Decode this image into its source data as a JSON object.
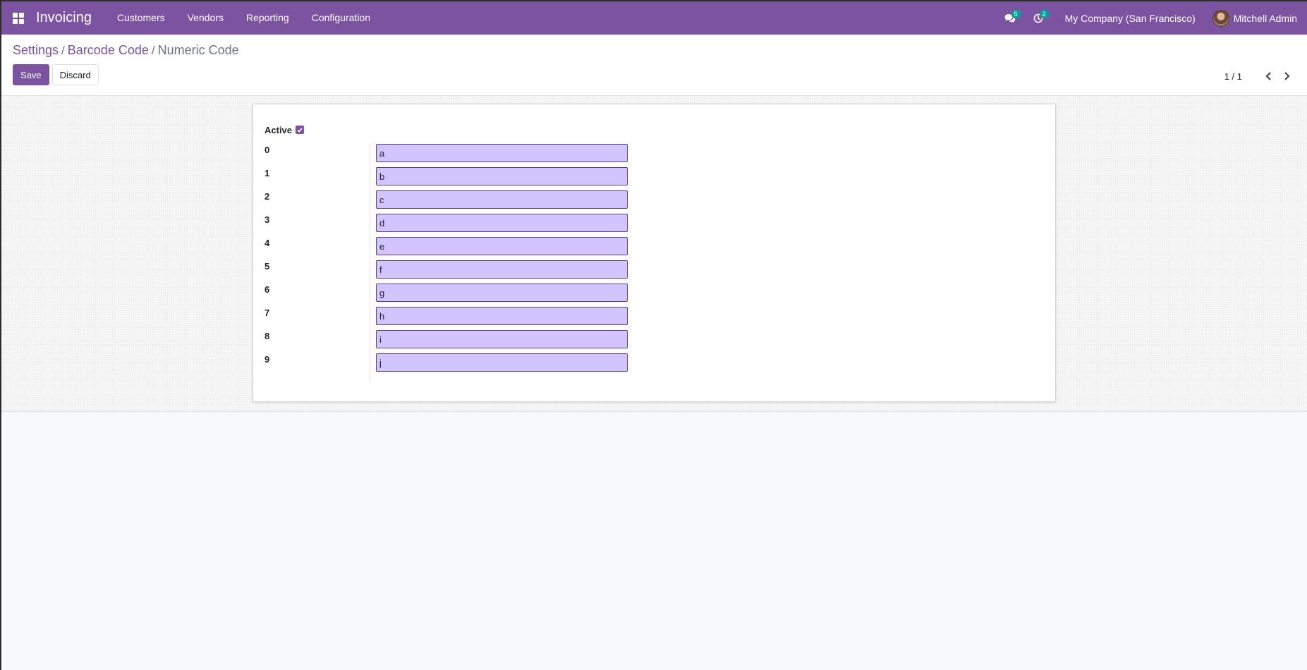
{
  "navbar": {
    "app_name": "Invoicing",
    "menu": [
      "Customers",
      "Vendors",
      "Reporting",
      "Configuration"
    ],
    "messages_count": "5",
    "activities_count": "2",
    "company": "My Company (San Francisco)",
    "user": "Mitchell Admin",
    "color": "#7c53a0"
  },
  "breadcrumb": {
    "items": [
      "Settings",
      "Barcode Code"
    ],
    "current": "Numeric Code"
  },
  "toolbar": {
    "save_label": "Save",
    "discard_label": "Discard"
  },
  "pager": {
    "value": "1 / 1"
  },
  "form": {
    "active_label": "Active",
    "active_checked": true,
    "rows": [
      {
        "label": "0",
        "value": "a"
      },
      {
        "label": "1",
        "value": "b"
      },
      {
        "label": "2",
        "value": "c"
      },
      {
        "label": "3",
        "value": "d"
      },
      {
        "label": "4",
        "value": "e"
      },
      {
        "label": "5",
        "value": "f"
      },
      {
        "label": "6",
        "value": "g"
      },
      {
        "label": "7",
        "value": "h"
      },
      {
        "label": "8",
        "value": "i"
      },
      {
        "label": "9",
        "value": "j"
      }
    ]
  }
}
